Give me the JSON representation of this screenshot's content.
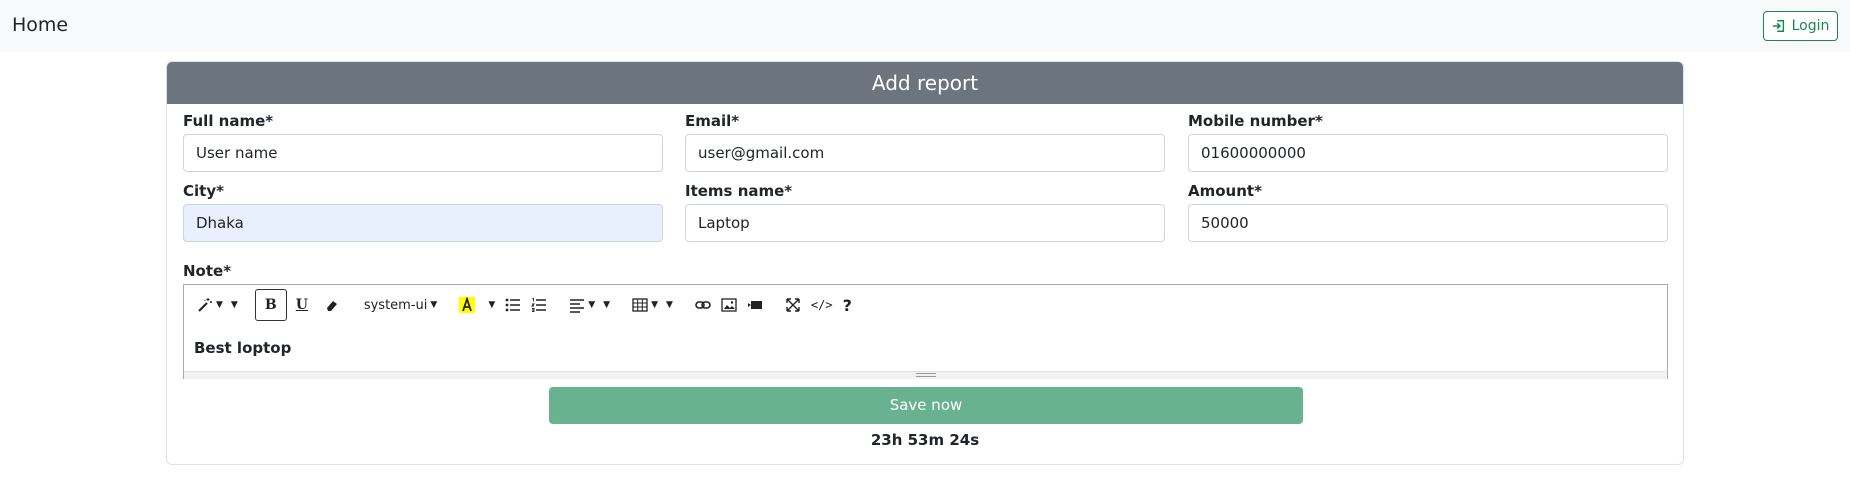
{
  "navbar": {
    "brand": "Home",
    "login_label": "Login"
  },
  "card": {
    "title": "Add report"
  },
  "fields": {
    "full_name": {
      "label": "Full name*",
      "value": "User name"
    },
    "email": {
      "label": "Email*",
      "value": "user@gmail.com"
    },
    "mobile": {
      "label": "Mobile number*",
      "value": "01600000000"
    },
    "city": {
      "label": "City*",
      "value": "Dhaka"
    },
    "items_name": {
      "label": "Items name*",
      "value": "Laptop"
    },
    "amount": {
      "label": "Amount*",
      "value": "50000"
    }
  },
  "note": {
    "label": "Note*",
    "content": "Best loptop",
    "toolbar": {
      "font_name": "system-ui",
      "bold": "B",
      "underline": "U",
      "help": "?"
    }
  },
  "actions": {
    "save_label": "Save now"
  },
  "timer": "23h 53m 24s",
  "colors": {
    "header": "#6c757d",
    "save": "#69b290",
    "login": "#198754",
    "autofill": "#e8f0fe"
  }
}
